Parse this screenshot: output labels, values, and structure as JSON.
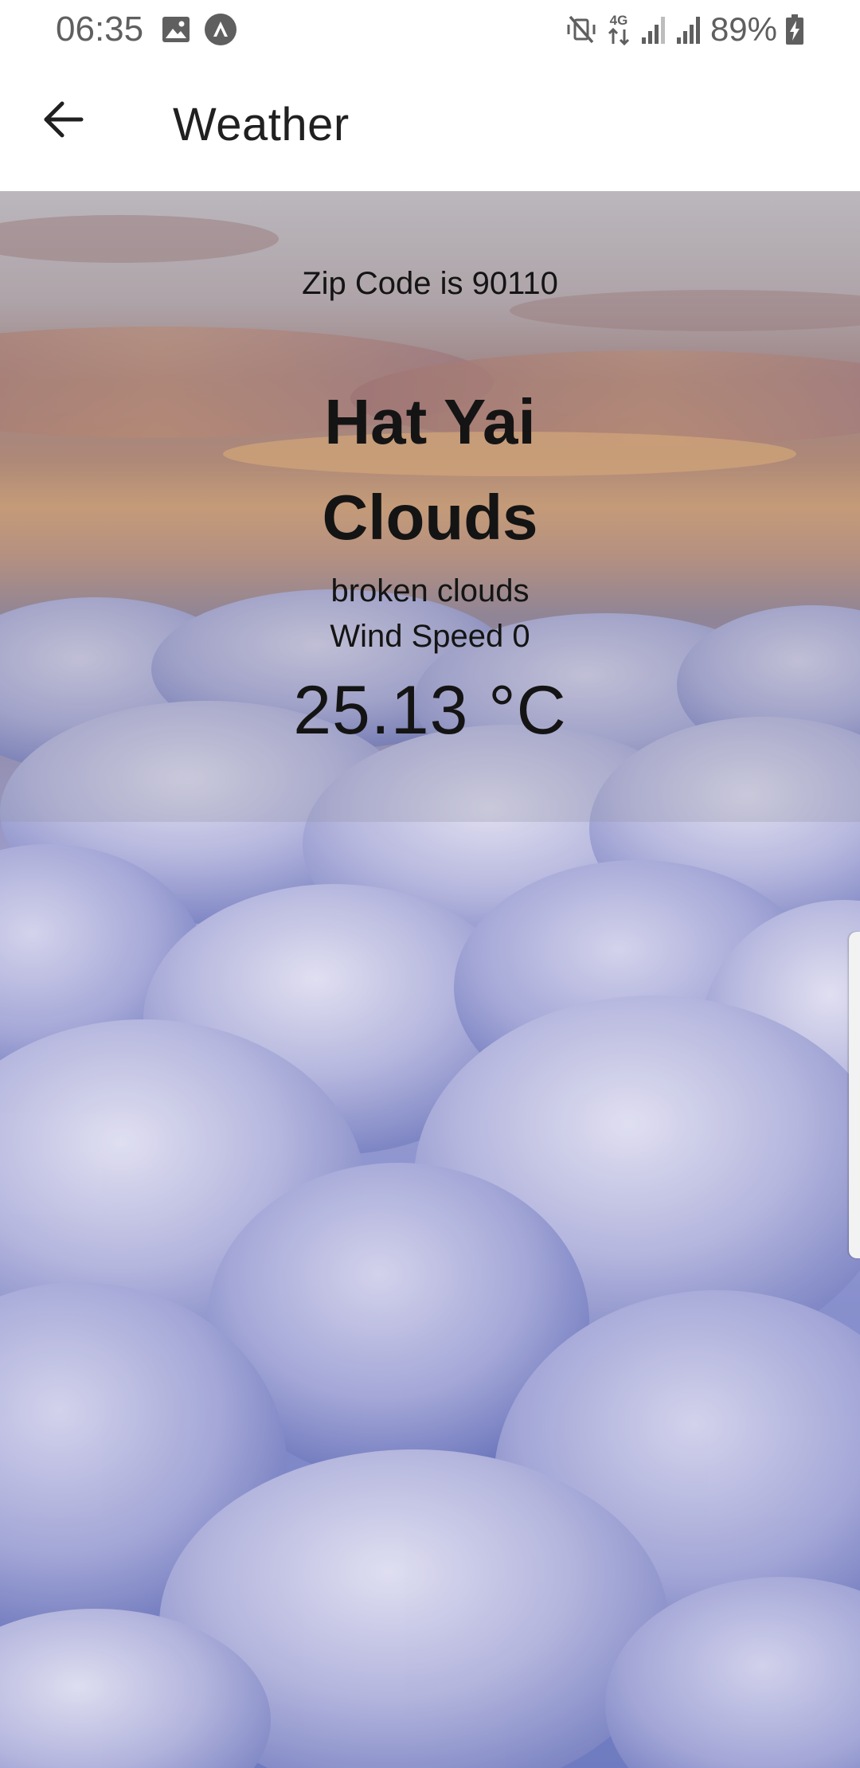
{
  "status_bar": {
    "time": "06:35",
    "battery_percent": "89%",
    "network_type": "4G",
    "icons": [
      "gallery-icon",
      "app-notification-icon",
      "mute-vibrate-icon",
      "network-4g-icon",
      "signal-icon",
      "signal-icon",
      "battery-charging-icon"
    ]
  },
  "app_bar": {
    "title": "Weather",
    "back_icon": "arrow-left-icon"
  },
  "weather": {
    "zip_code_text": "Zip Code is 90110",
    "city": "Hat Yai",
    "condition": "Clouds",
    "description": "broken clouds",
    "wind_speed_text": "Wind Speed 0",
    "temperature": "25.13 °C"
  },
  "colors": {
    "app_bar_background": "#ffffff",
    "title_text": "#202020",
    "status_text": "#5f5f5f",
    "content_text": "#141414",
    "cloud_tint": "#8a8fc8",
    "sunset_orange": "#e89a5a"
  }
}
